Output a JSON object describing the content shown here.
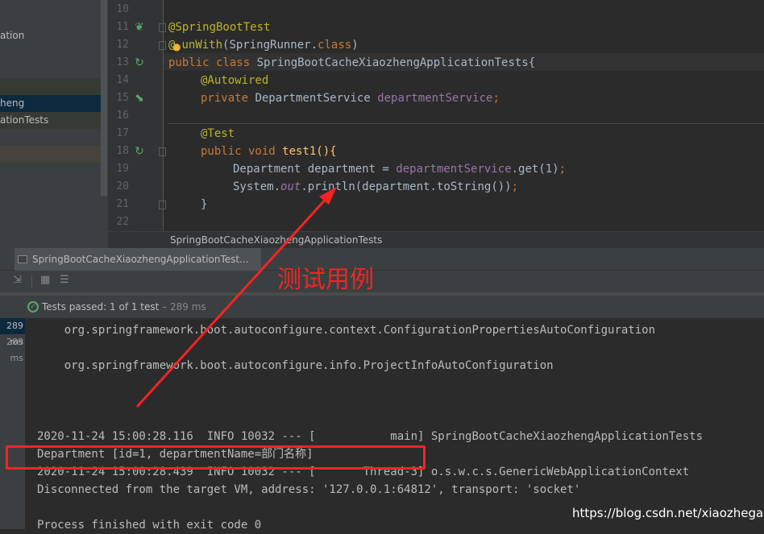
{
  "project_tree": {
    "items": [
      "ation",
      "heng",
      "ationTests"
    ]
  },
  "editor": {
    "line_numbers": [
      "10",
      "11",
      "12",
      "13",
      "14",
      "15",
      "16",
      "17",
      "18",
      "19",
      "20",
      "21",
      "22"
    ],
    "lines": {
      "l11": "@SpringBootTest",
      "l12a": "@",
      "l12b": "unWith",
      "l12c": "(SpringRunner.",
      "l12d": "class",
      "l12e": ")",
      "l13a": "public class ",
      "l13b": "SpringBootCacheXiaozhengApplicationTests{",
      "l14": "@Autowired",
      "l15a": "private ",
      "l15b": "DepartmentService ",
      "l15c": "departmentService",
      "l15d": ";",
      "l17": "@Test",
      "l18a": "public void ",
      "l18b": "test1(){",
      "l19a": "Department department = ",
      "l19b": "departmentService",
      ".": "",
      "l19c": ".get(1)",
      "l19d": ";",
      "l20a": "System.",
      "l20b": "out",
      "l20c": ".println(department.toString())",
      "l20d": ";",
      "l21": "}"
    }
  },
  "breadcrumb": "SpringBootCacheXiaozhengApplicationTests",
  "run_tab": {
    "label": "SpringBootCacheXiaozhengApplicationTest...",
    "close": "×"
  },
  "status": {
    "label": "Tests passed: ",
    "count": "1 of 1 test",
    "time": " – 289 ms"
  },
  "times": [
    "289 ms",
    "289 ms"
  ],
  "console": [
    "    org.springframework.boot.autoconfigure.context.ConfigurationPropertiesAutoConfiguration",
    "    org.springframework.boot.autoconfigure.info.ProjectInfoAutoConfiguration",
    "2020-11-24 15:00:28.116  INFO 10032 --- [           main] SpringBootCacheXiaozhengApplicationTests",
    "Department [id=1, departmentName=部门名称]",
    "2020-11-24 15:00:28.439  INFO 10032 --- [       Thread-3] o.s.w.c.s.GenericWebApplicationContext",
    "Disconnected from the target VM, address: '127.0.0.1:64812', transport: 'socket'",
    "Process finished with exit code 0"
  ],
  "annotation": {
    "label": "测试用例",
    "color": "#F42424"
  },
  "watermark": "https://blog.csdn.net/xiaozhegaa",
  "colors": {
    "annotation": "#BBB529",
    "keyword": "#CC7832",
    "field": "#9876AA",
    "text": "#A9B7C6",
    "pass": "#59A869"
  }
}
